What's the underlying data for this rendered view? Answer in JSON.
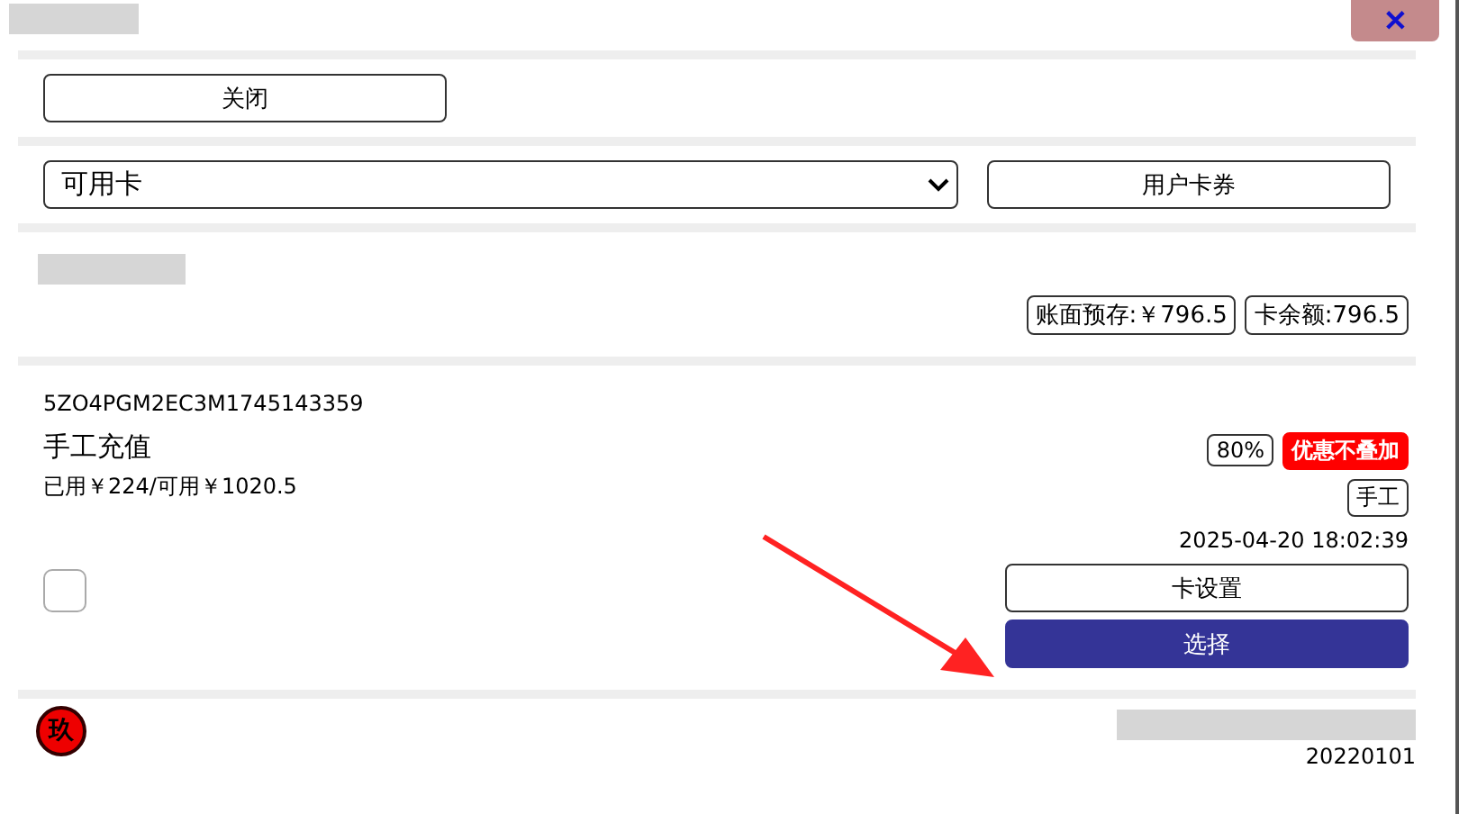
{
  "header": {
    "close_icon": "✕"
  },
  "close_button": "关闭",
  "filter": {
    "value": "可用卡",
    "button": "用户卡券"
  },
  "balances": [
    "账面预存:￥796.5",
    "卡余额:796.5"
  ],
  "card": {
    "code": "5ZO4PGM2EC3M1745143359",
    "name": "手工充值",
    "usage": "已用￥224/可用￥1020.5",
    "tags": [
      {
        "text": "80%",
        "kind": "outline"
      },
      {
        "text": "优惠不叠加",
        "kind": "alert"
      },
      {
        "text": "手工",
        "kind": "outline"
      }
    ],
    "time": "2025-04-20 18:02:39",
    "checked": false,
    "settings_button": "卡设置",
    "select_button": "选择"
  },
  "footer": {
    "logo": "玖",
    "version": "20220101"
  }
}
